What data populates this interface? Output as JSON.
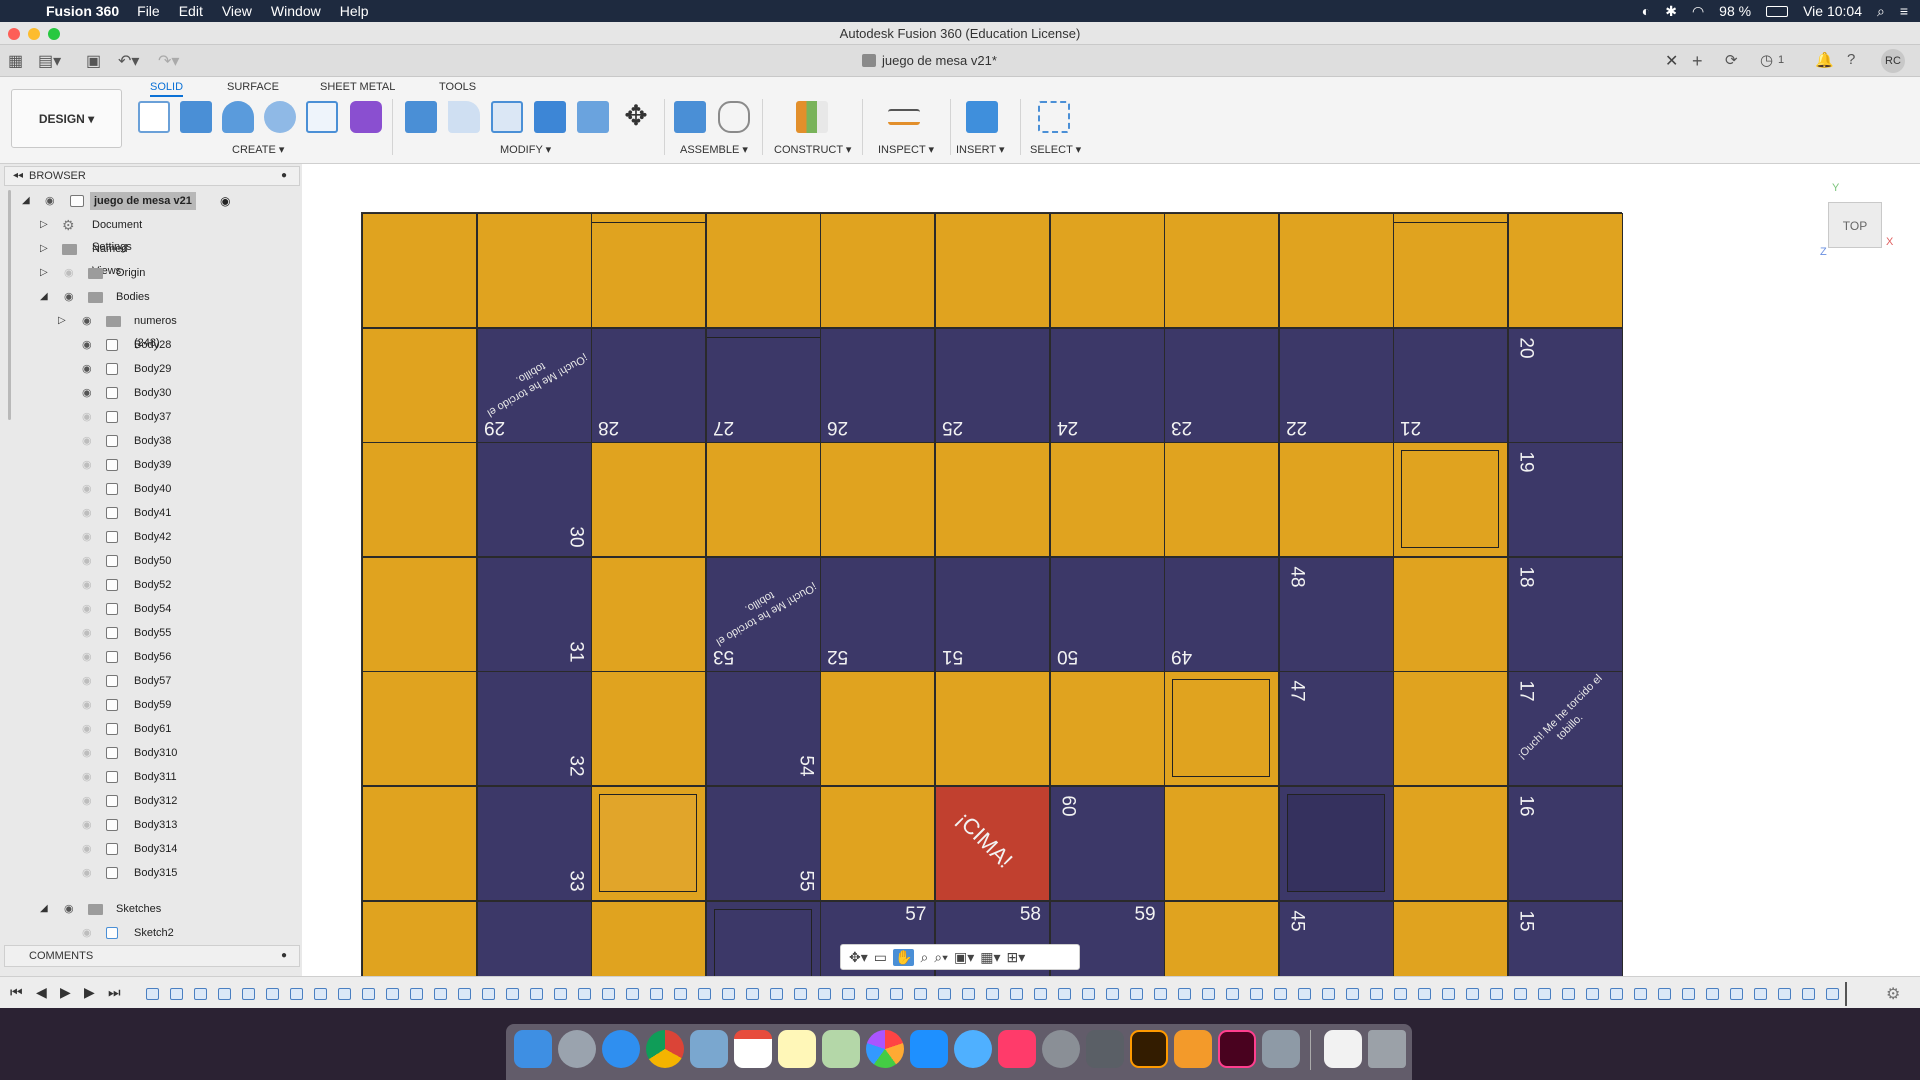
{
  "menubar": {
    "app": "Fusion 360",
    "items": [
      "File",
      "Edit",
      "View",
      "Window",
      "Help"
    ],
    "battery": "98 %",
    "clock": "Vie 10:04"
  },
  "window": {
    "title": "Autodesk Fusion 360 (Education License)"
  },
  "document": {
    "tab_title": "juego de mesa v21*",
    "user_initials": "RC",
    "jobs_count": "1"
  },
  "ribbon": {
    "workspace": "DESIGN ▾",
    "tabs": [
      "SOLID",
      "SURFACE",
      "SHEET METAL",
      "TOOLS"
    ],
    "groups": [
      "CREATE ▾",
      "MODIFY ▾",
      "ASSEMBLE ▾",
      "CONSTRUCT ▾",
      "INSPECT ▾",
      "INSERT ▾",
      "SELECT ▾"
    ]
  },
  "browser": {
    "title": "BROWSER",
    "root": "juego de mesa v21",
    "nodes": [
      "Document Settings",
      "Named Views",
      "Origin",
      "Bodies",
      "numeros (248)"
    ],
    "bodies": [
      "Body28",
      "Body29",
      "Body30",
      "Body37",
      "Body38",
      "Body39",
      "Body40",
      "Body41",
      "Body42",
      "Body50",
      "Body52",
      "Body54",
      "Body55",
      "Body56",
      "Body57",
      "Body59",
      "Body61",
      "Body310",
      "Body311",
      "Body312",
      "Body313",
      "Body314",
      "Body315"
    ],
    "sketches_label": "Sketches",
    "sketch": "Sketch2",
    "comments": "COMMENTS"
  },
  "viewcube": {
    "face": "TOP",
    "axis_x": "X",
    "axis_y": "Y",
    "axis_z": "Z"
  },
  "board": {
    "colors": {
      "yellow": "#e0a31f",
      "purple": "#3c3868",
      "red": "#c1402f"
    },
    "numbers": [
      "20",
      "21",
      "22",
      "23",
      "24",
      "25",
      "26",
      "27",
      "28",
      "29",
      "30",
      "31",
      "32",
      "33",
      "19",
      "18",
      "17",
      "16",
      "15",
      "48",
      "47",
      "45",
      "49",
      "50",
      "51",
      "52",
      "53",
      "54",
      "55",
      "57",
      "58",
      "59",
      "60"
    ],
    "ouch_text": "¡Ouch! Me he torcido el tobillo.",
    "goal_text": "¡CIMA!"
  }
}
